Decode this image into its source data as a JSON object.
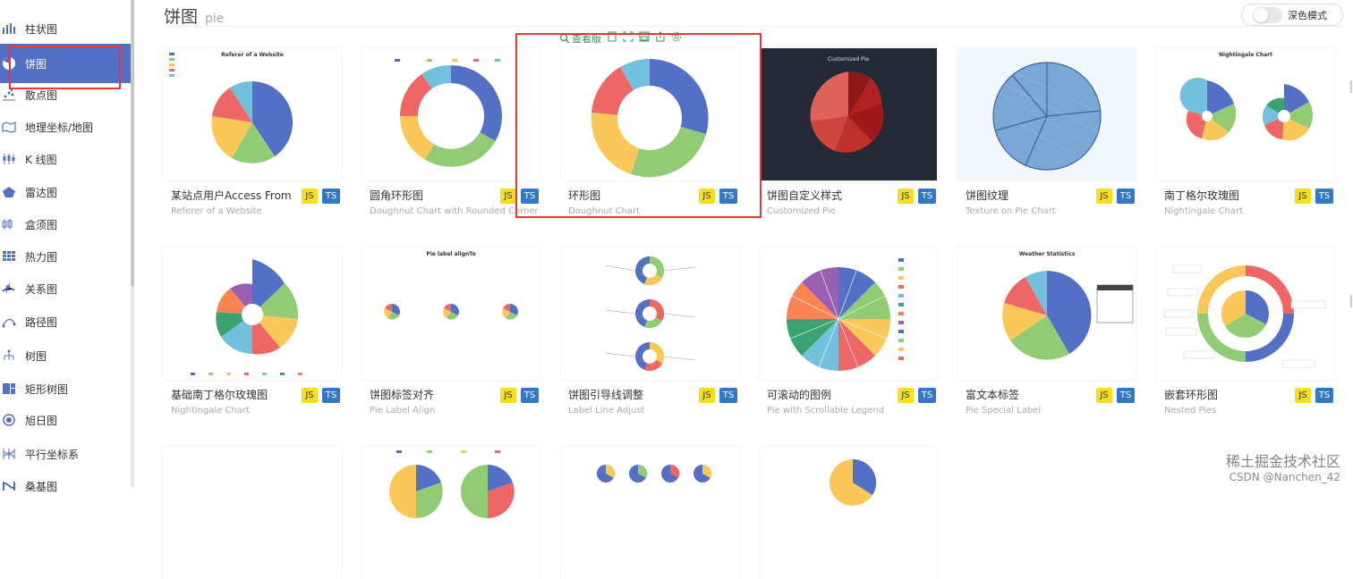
{
  "sidebar": {
    "items": [
      {
        "label": "柱状图",
        "icon": "bar-chart-icon"
      },
      {
        "label": "饼图",
        "icon": "pie-chart-icon",
        "active": true
      },
      {
        "label": "散点图",
        "icon": "scatter-chart-icon"
      },
      {
        "label": "地理坐标/地图",
        "icon": "map-icon"
      },
      {
        "label": "K 线图",
        "icon": "candlestick-icon"
      },
      {
        "label": "雷达图",
        "icon": "radar-icon"
      },
      {
        "label": "盒须图",
        "icon": "boxplot-icon"
      },
      {
        "label": "热力图",
        "icon": "heatmap-icon"
      },
      {
        "label": "关系图",
        "icon": "graph-icon"
      },
      {
        "label": "路径图",
        "icon": "lines-icon"
      },
      {
        "label": "树图",
        "icon": "tree-icon"
      },
      {
        "label": "矩形树图",
        "icon": "treemap-icon"
      },
      {
        "label": "旭日图",
        "icon": "sunburst-icon"
      },
      {
        "label": "平行坐标系",
        "icon": "parallel-icon"
      },
      {
        "label": "桑基图",
        "icon": "sankey-icon"
      }
    ]
  },
  "header": {
    "title": "饼图",
    "subtitle": "pie",
    "dark_mode_label": "深色模式",
    "dark_mode_on": false
  },
  "hover_toolbar": {
    "view_label": "查看版",
    "icons": [
      "copy-icon",
      "fullscreen-icon",
      "save-icon",
      "share-icon",
      "settings-icon"
    ]
  },
  "badges": {
    "js": "JS",
    "ts": "TS"
  },
  "cards": [
    {
      "name": "某站点用户Access From",
      "subtitle": "Referer of a Website",
      "thumb_title": "Referer of a Website"
    },
    {
      "name": "圆角环形图",
      "subtitle": "Doughnut Chart with Rounded Corner"
    },
    {
      "name": "环形图",
      "subtitle": "Doughnut Chart"
    },
    {
      "name": "饼图自定义样式",
      "subtitle": "Customized Pie",
      "thumb_title": "Customized Pie"
    },
    {
      "name": "饼图纹理",
      "subtitle": "Texture on Pie Chart"
    },
    {
      "name": "南丁格尔玫瑰图",
      "subtitle": "Nightingale Chart",
      "thumb_title": "Nightingale Chart"
    },
    {
      "name": "基础南丁格尔玫瑰图",
      "subtitle": "Nightingale Chart"
    },
    {
      "name": "饼图标签对齐",
      "subtitle": "Pie Label Align",
      "thumb_title": "Pie label alignTo"
    },
    {
      "name": "饼图引导线调整",
      "subtitle": "Label Line Adjust"
    },
    {
      "name": "可滚动的图例",
      "subtitle": "Pie with Scrollable Legend"
    },
    {
      "name": "富文本标签",
      "subtitle": "Pie Special Label",
      "thumb_title": "Weather Statistics"
    },
    {
      "name": "嵌套环形图",
      "subtitle": "Nested Pies"
    }
  ],
  "watermark": {
    "line1": "稀土掘金技术社区",
    "line2": "CSDN @Nanchen_42"
  },
  "colors": {
    "accent": "#5470c6",
    "highlight_border": "#e53935",
    "palette": [
      "#5470c6",
      "#91cc75",
      "#fac858",
      "#ee6666",
      "#73c0de",
      "#3ba272",
      "#fc8452",
      "#9a60b4"
    ]
  }
}
